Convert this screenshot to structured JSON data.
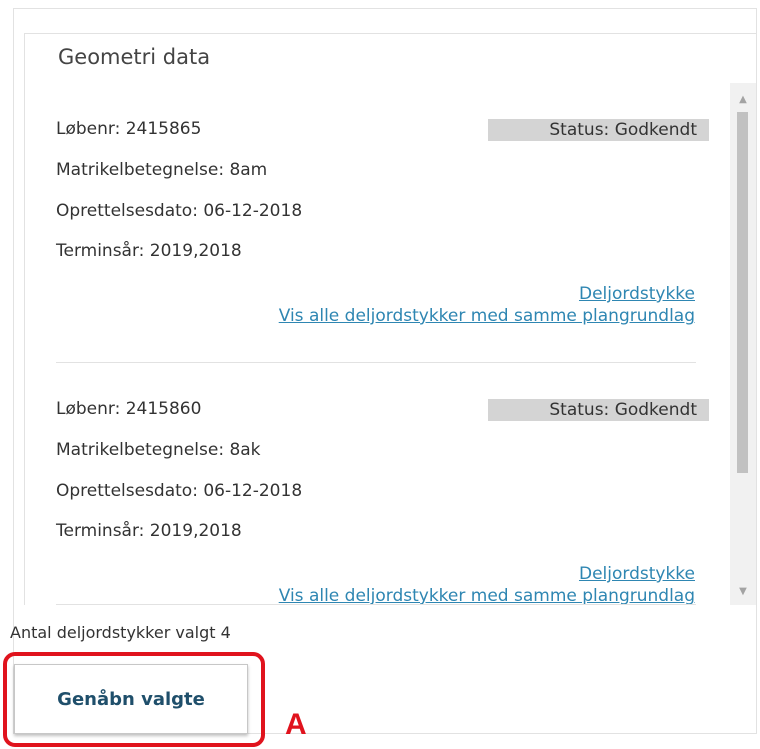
{
  "panel": {
    "title": "Geometri data"
  },
  "records": [
    {
      "loebenr": "Løbenr: 2415865",
      "status": "Status: Godkendt",
      "matrikel": "Matrikelbetegnelse: 8am",
      "oprettelse": "Oprettelsesdato: 06-12-2018",
      "termin": "Terminsår: 2019,2018",
      "link_deljordstykke": "Deljordstykke",
      "link_vis_alle": "Vis alle deljordstykker med samme plangrundlag"
    },
    {
      "loebenr": "Løbenr: 2415860",
      "status": "Status: Godkendt",
      "matrikel": "Matrikelbetegnelse: 8ak",
      "oprettelse": "Oprettelsesdato: 06-12-2018",
      "termin": "Terminsår: 2019,2018",
      "link_deljordstykke": "Deljordstykke",
      "link_vis_alle": "Vis alle deljordstykker med samme plangrundlag"
    }
  ],
  "footer": {
    "count_text": "Antal deljordstykker valgt 4",
    "reopen_button_label": "Genåbn valgte",
    "annotation_letter": "A"
  },
  "colors": {
    "link": "#2e86b2",
    "status_bg": "#d4d4d4",
    "highlight": "#e0131d",
    "button_text": "#1f4f6b"
  },
  "icons": {
    "scroll_up": "scroll-up-arrow-icon",
    "scroll_down": "scroll-down-arrow-icon"
  }
}
